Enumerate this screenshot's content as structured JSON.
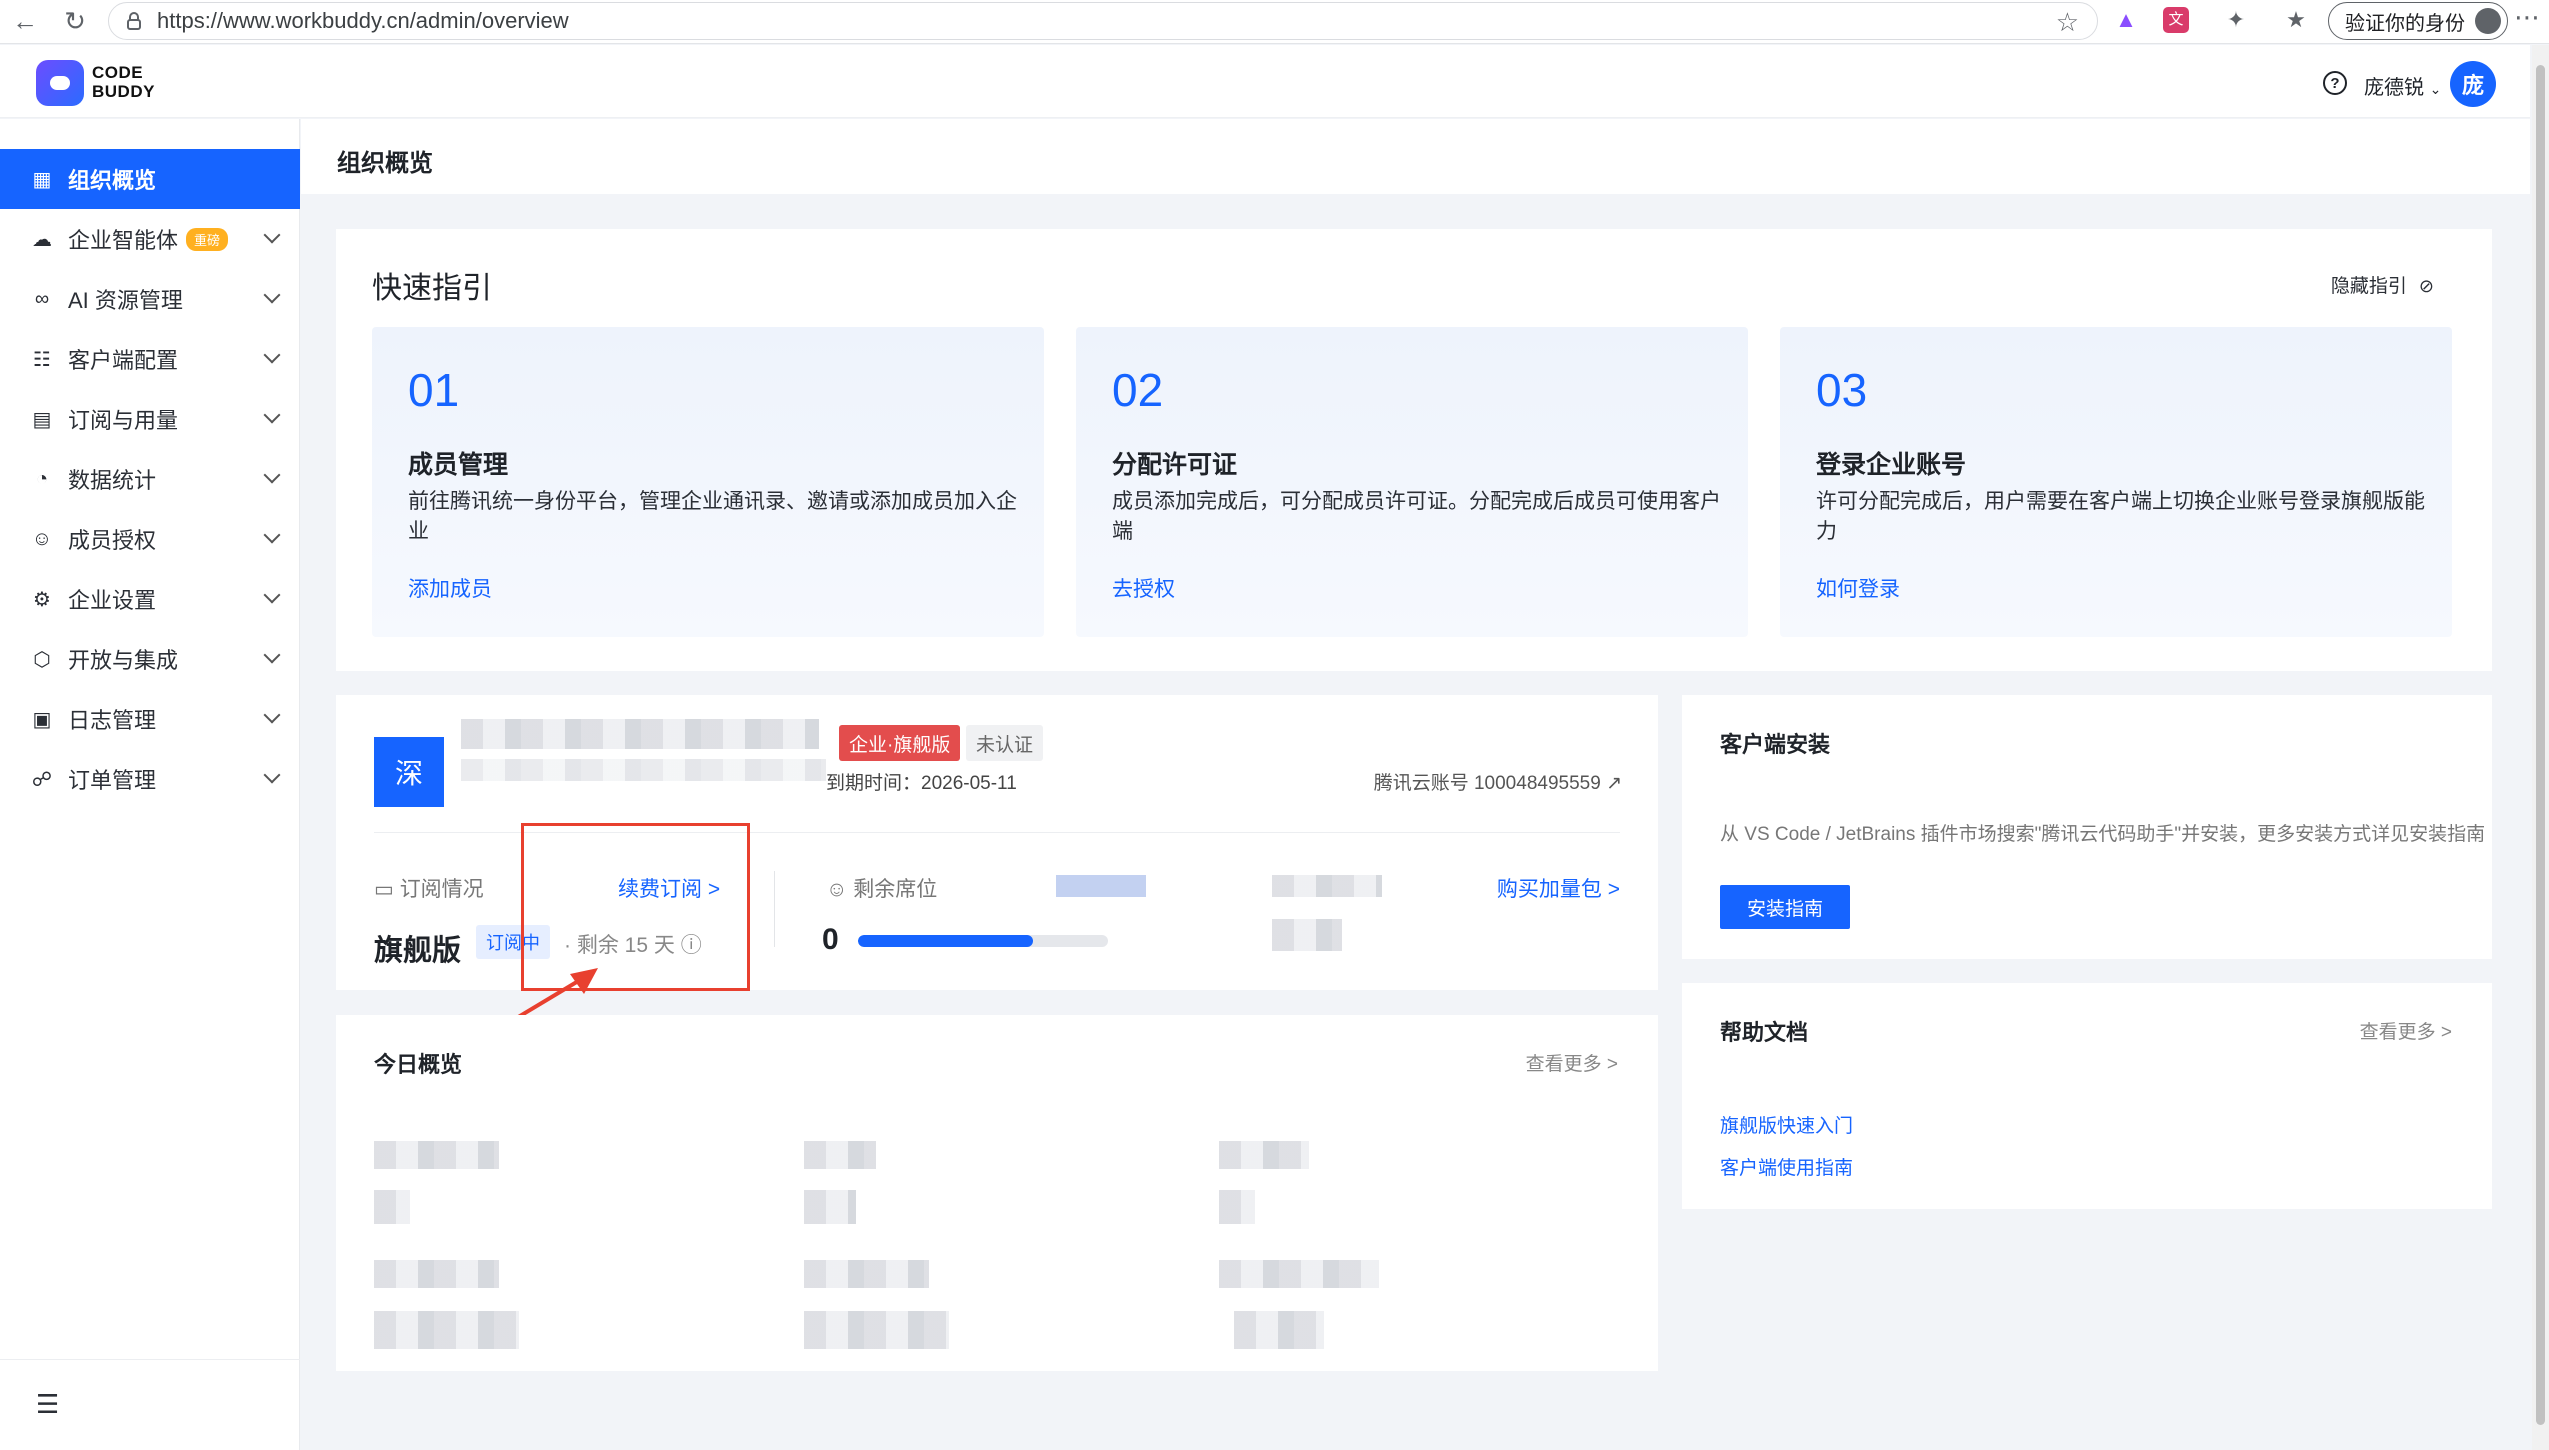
{
  "browser": {
    "url": "https://www.workbuddy.cn/admin/overview",
    "identity_label": "验证你的身份"
  },
  "header": {
    "logo_text": "CODE\nBUDDY",
    "user_name": "庞德锐",
    "avatar_initial": "庞"
  },
  "sidebar": {
    "items": [
      {
        "label": "组织概览",
        "icon": "grid-icon",
        "active": true
      },
      {
        "label": "企业智能体",
        "icon": "cloud-icon",
        "badge": "重磅"
      },
      {
        "label": "AI 资源管理",
        "icon": "infinity-icon"
      },
      {
        "label": "客户端配置",
        "icon": "apps-icon"
      },
      {
        "label": "订阅与用量",
        "icon": "bar-chart-icon"
      },
      {
        "label": "数据统计",
        "icon": "pie-chart-icon"
      },
      {
        "label": "成员授权",
        "icon": "user-icon"
      },
      {
        "label": "企业设置",
        "icon": "settings-icon"
      },
      {
        "label": "开放与集成",
        "icon": "cube-icon"
      },
      {
        "label": "日志管理",
        "icon": "calendar-icon"
      },
      {
        "label": "订单管理",
        "icon": "cart-icon"
      }
    ]
  },
  "page": {
    "title": "组织概览"
  },
  "guide": {
    "title": "快速指引",
    "hide_label": "隐藏指引",
    "steps": [
      {
        "num": "01",
        "title": "成员管理",
        "desc": "前往腾讯统一身份平台，管理企业通讯录、邀请或添加成员加入企业",
        "link": "添加成员"
      },
      {
        "num": "02",
        "title": "分配许可证",
        "desc": "成员添加完成后，可分配成员许可证。分配完成后成员可使用客户端",
        "link": "去授权"
      },
      {
        "num": "03",
        "title": "登录企业账号",
        "desc": "许可分配完成后，用户需要在客户端上切换企业账号登录旗舰版能力",
        "link": "如何登录"
      }
    ]
  },
  "org": {
    "avatar_char": "深",
    "tag_edition": "企业·旗舰版",
    "tag_status": "未认证",
    "expire_text": "到期时间：2026-05-11",
    "account_text": "腾讯云账号 100048495559",
    "subscription_label": "订阅情况",
    "renew_link": "续费订阅 >",
    "plan_name": "旗舰版",
    "plan_status": "订阅中",
    "remaining_text": "· 剩余 15 天",
    "seat_label": "剩余席位",
    "seat_value": "0",
    "seat_progress": 0.7,
    "buy_link": "购买加量包 >"
  },
  "today": {
    "title": "今日概览",
    "more": "查看更多 >"
  },
  "install": {
    "title": "客户端安装",
    "desc": "从 VS Code / JetBrains 插件市场搜索\"腾讯云代码助手\"并安装，更多安装方式详见安装指南",
    "button": "安装指南"
  },
  "help": {
    "title": "帮助文档",
    "more": "查看更多 >",
    "links": [
      "旗舰版快速入门",
      "客户端使用指南"
    ]
  },
  "colors": {
    "accent": "#1664ff",
    "danger": "#e34d4d",
    "annotation": "#e8402f"
  }
}
